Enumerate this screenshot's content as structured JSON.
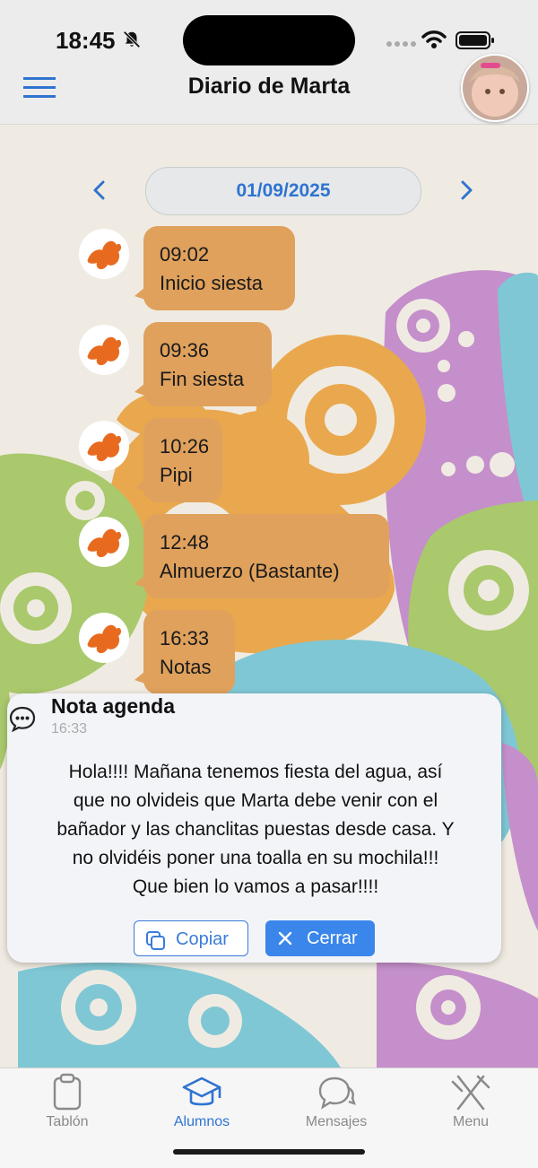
{
  "status": {
    "time": "18:45"
  },
  "header": {
    "title": "Diario de Marta"
  },
  "date_nav": {
    "date": "01/09/2025"
  },
  "entries": [
    {
      "time": "09:02",
      "text": "Inicio siesta"
    },
    {
      "time": "09:36",
      "text": "Fin siesta"
    },
    {
      "time": "10:26",
      "text": "Pipi"
    },
    {
      "time": "12:48",
      "text": "Almuerzo (Bastante)"
    },
    {
      "time": "16:33",
      "text": "Notas"
    }
  ],
  "note": {
    "title": "Nota agenda",
    "time": "16:33",
    "body_lines": [
      "Hola!!!! Mañana tenemos fiesta del agua, así",
      "que no olvideis que Marta debe venir con el",
      "bañador y las chanclitas puestas desde casa. Y",
      "no olvidéis poner una toalla en su mochila!!!",
      "Que bien lo vamos a pasar!!!!"
    ],
    "copy_label": "Copiar",
    "close_label": "Cerrar"
  },
  "tabs": [
    {
      "label": "Tablón",
      "icon": "clipboard-icon",
      "active": false
    },
    {
      "label": "Alumnos",
      "icon": "graduation-cap-icon",
      "active": true
    },
    {
      "label": "Mensajes",
      "icon": "chat-bubbles-icon",
      "active": false
    },
    {
      "label": "Menu",
      "icon": "fork-knife-icon",
      "active": false
    }
  ],
  "colors": {
    "accent": "#2f74d0",
    "bubble": "#dfa15c",
    "bubble_icon": "#e86a1f",
    "art_orange": "#e9a84e",
    "art_purple": "#c58fcb",
    "art_green": "#a9c96c",
    "art_blue": "#7fc7d4"
  }
}
